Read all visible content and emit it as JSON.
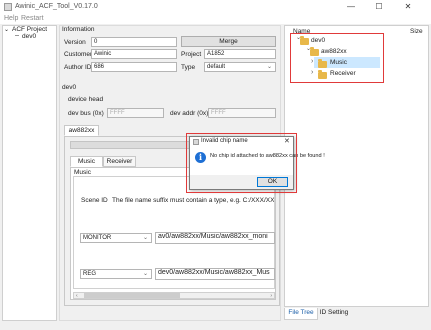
{
  "window": {
    "title": "Awinic_ACF_Tool_V0.17.0",
    "min_glyph": "—",
    "max_glyph": "☐",
    "close_glyph": "✕"
  },
  "menu": [
    "Help",
    "Restart"
  ],
  "left_tree": {
    "root": "ACF Project",
    "child": "dev0",
    "expand_glyph": "⌄"
  },
  "information": {
    "title": "Information",
    "version_label": "Version",
    "version_value": "0",
    "merge_label": "Merge",
    "customer_label": "Customer",
    "customer_value": "Awinic",
    "project_label": "Project",
    "project_value": "A1852",
    "author_label": "Author ID",
    "author_value": "686",
    "type_label": "Type",
    "type_value": "default"
  },
  "device": {
    "section": "dev0",
    "head_title": "device head",
    "bus_label": "dev bus (0x)",
    "bus_placeholder": "FFFF",
    "addr_label": "dev addr (0x)",
    "addr_placeholder": "FFFF"
  },
  "chip_tab": "aw882xx",
  "sub_tabs": [
    "Music",
    "Receiver"
  ],
  "music_group": "Music",
  "scene": {
    "label": "Scene ID",
    "hint": "The file name suffix must contain a type, e.g. C:/XXX/XXXX_d"
  },
  "rows": [
    {
      "select": "MONITOR",
      "path": "av0/aw882xx/Music/aw882xx_moni"
    },
    {
      "select": "REG",
      "path": "dev0/aw882xx/Music/aw882xx_Mus"
    }
  ],
  "right_panel": {
    "col_name": "Name",
    "col_size": "Size",
    "tree": [
      {
        "label": "dev0",
        "level": 0,
        "arrow": "⌄"
      },
      {
        "label": "aw882xx",
        "level": 1,
        "arrow": "⌄"
      },
      {
        "label": "Music",
        "level": 2,
        "arrow": "›",
        "selected": true
      },
      {
        "label": "Receiver",
        "level": 2,
        "arrow": "›"
      }
    ],
    "bottom_tabs": [
      "File Tree",
      "ID Setting"
    ]
  },
  "dialog": {
    "title": "Invalid chip name",
    "icon": "i",
    "message": "No chip id attached to aw882xx can be found !",
    "ok": "OK",
    "close_glyph": "✕"
  },
  "colors": {
    "accent": "#0078d7",
    "highlight": "#e03a3a",
    "folder": "#e8b84a",
    "selection": "#cce8ff",
    "info": "#1e6fd4"
  }
}
